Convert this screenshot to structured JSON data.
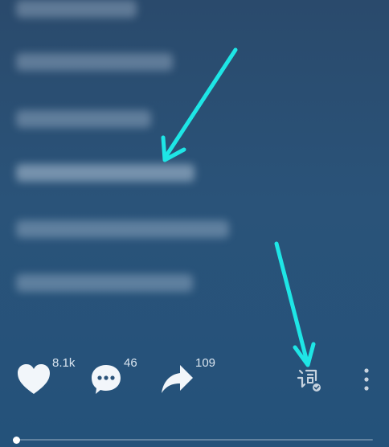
{
  "lyrics": {
    "lines": [
      "",
      "",
      "",
      "",
      "",
      ""
    ]
  },
  "actions": {
    "like_count": "8.1k",
    "comment_count": "46",
    "share_count": "109"
  },
  "playback": {
    "progress": 0.0
  },
  "colors": {
    "annotation_arrow": "#1ee6e6",
    "icon_white": "#f2f6fa",
    "background_top": "#2a4a6c",
    "background_bottom": "#24527a"
  },
  "icons": [
    "heart-icon",
    "comment-bubble-icon",
    "share-arrow-icon",
    "lyrics-icon",
    "more-vertical-icon"
  ]
}
